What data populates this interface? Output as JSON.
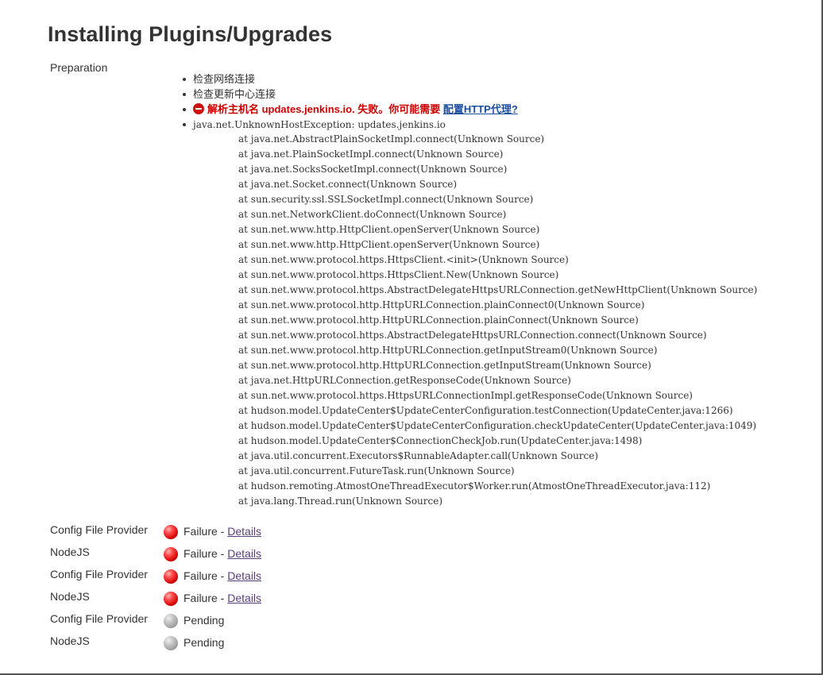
{
  "page": {
    "title": "Installing Plugins/Upgrades"
  },
  "preparation": {
    "label": "Preparation",
    "items": [
      "检查网络连接",
      "检查更新中心连接"
    ],
    "error_text": "解析主机名 updates.jenkins.io. 失败。你可能需要",
    "proxy_link": "配置HTTP代理?",
    "exception": "java.net.UnknownHostException: updates.jenkins.io",
    "stack_trace": [
      "at java.net.AbstractPlainSocketImpl.connect(Unknown Source)",
      "at java.net.PlainSocketImpl.connect(Unknown Source)",
      "at java.net.SocksSocketImpl.connect(Unknown Source)",
      "at java.net.Socket.connect(Unknown Source)",
      "at sun.security.ssl.SSLSocketImpl.connect(Unknown Source)",
      "at sun.net.NetworkClient.doConnect(Unknown Source)",
      "at sun.net.www.http.HttpClient.openServer(Unknown Source)",
      "at sun.net.www.http.HttpClient.openServer(Unknown Source)",
      "at sun.net.www.protocol.https.HttpsClient.<init>(Unknown Source)",
      "at sun.net.www.protocol.https.HttpsClient.New(Unknown Source)",
      "at sun.net.www.protocol.https.AbstractDelegateHttpsURLConnection.getNewHttpClient(Unknown Source)",
      "at sun.net.www.protocol.http.HttpURLConnection.plainConnect0(Unknown Source)",
      "at sun.net.www.protocol.http.HttpURLConnection.plainConnect(Unknown Source)",
      "at sun.net.www.protocol.https.AbstractDelegateHttpsURLConnection.connect(Unknown Source)",
      "at sun.net.www.protocol.http.HttpURLConnection.getInputStream0(Unknown Source)",
      "at sun.net.www.protocol.http.HttpURLConnection.getInputStream(Unknown Source)",
      "at java.net.HttpURLConnection.getResponseCode(Unknown Source)",
      "at sun.net.www.protocol.https.HttpsURLConnectionImpl.getResponseCode(Unknown Source)",
      "at hudson.model.UpdateCenter$UpdateCenterConfiguration.testConnection(UpdateCenter.java:1266)",
      "at hudson.model.UpdateCenter$UpdateCenterConfiguration.checkUpdateCenter(UpdateCenter.java:1049)",
      "at hudson.model.UpdateCenter$ConnectionCheckJob.run(UpdateCenter.java:1498)",
      "at java.util.concurrent.Executors$RunnableAdapter.call(Unknown Source)",
      "at java.util.concurrent.FutureTask.run(Unknown Source)",
      "at hudson.remoting.AtmostOneThreadExecutor$Worker.run(AtmostOneThreadExecutor.java:112)",
      "at java.lang.Thread.run(Unknown Source)"
    ]
  },
  "plugins": [
    {
      "name": "Config File Provider",
      "status": "failure",
      "status_label": "Failure",
      "separator": " - ",
      "details_label": "Details"
    },
    {
      "name": "NodeJS",
      "status": "failure",
      "status_label": "Failure",
      "separator": " - ",
      "details_label": "Details"
    },
    {
      "name": "Config File Provider",
      "status": "failure",
      "status_label": "Failure",
      "separator": " - ",
      "details_label": "Details"
    },
    {
      "name": "NodeJS",
      "status": "failure",
      "status_label": "Failure",
      "separator": " - ",
      "details_label": "Details"
    },
    {
      "name": "Config File Provider",
      "status": "pending",
      "status_label": "Pending"
    },
    {
      "name": "NodeJS",
      "status": "pending",
      "status_label": "Pending"
    }
  ],
  "colors": {
    "error": "#cc0000",
    "link": "#1a4fa0",
    "visited_link": "#5a3e7a",
    "failure_ball": "#d40000",
    "pending_ball": "#9a9a9a"
  },
  "icons": {
    "error": "error-circle-icon",
    "failure": "red-ball-icon",
    "pending": "grey-ball-icon"
  }
}
